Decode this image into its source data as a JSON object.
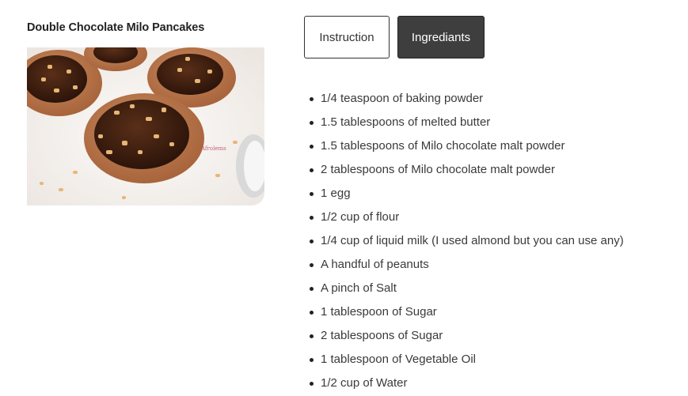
{
  "recipe": {
    "title": "Double Chocolate Milo Pancakes",
    "photo_watermark": "Afrolems"
  },
  "tabs": {
    "instruction_label": "Instruction",
    "ingredients_label": "Ingrediants",
    "active": "ingredients"
  },
  "ingredients": [
    "1/4 teaspoon of baking powder",
    "1.5 tablespoons of melted butter",
    "1.5 tablespoons of Milo chocolate malt powder",
    "2 tablespoons of Milo chocolate malt powder",
    "1 egg",
    "1/2 cup of flour",
    "1/4 cup of liquid milk (I used almond but you can use any)",
    "A handful of peanuts",
    "A pinch of Salt",
    "1 tablespoon of Sugar",
    "2 tablespoons of Sugar",
    "1 tablespoon of Vegetable Oil",
    "1/2 cup of Water"
  ],
  "colors": {
    "active_tab_bg": "#3e3e3e",
    "tab_border": "#333333",
    "text": "#3a3a3a"
  }
}
